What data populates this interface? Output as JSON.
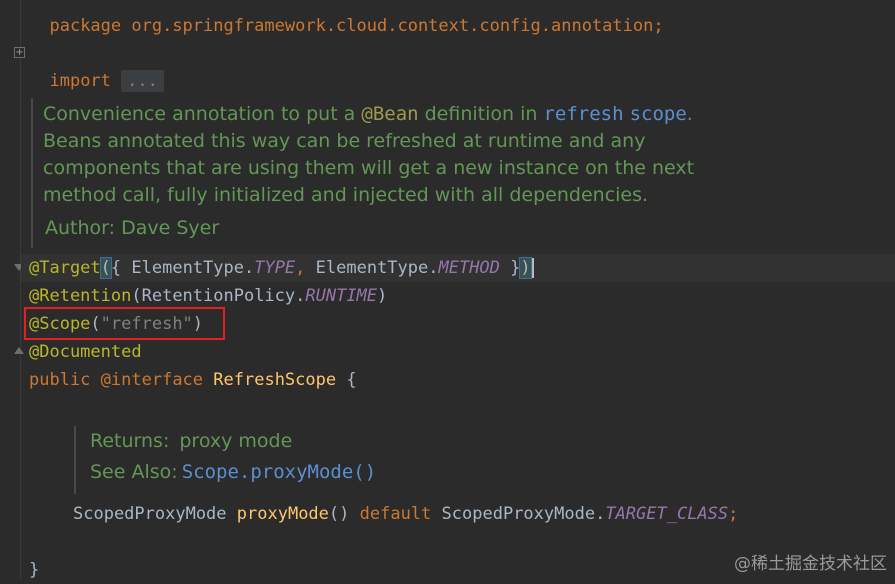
{
  "editor": {
    "line_package": "package org.springframework.cloud.context.config.annotation;",
    "import_keyword": "import",
    "import_ellipsis": "...",
    "doc_class": {
      "text_part1": "Convenience annotation to put a ",
      "text_bean": "@Bean",
      "text_part2": " definition in ",
      "text_refresh": "refresh",
      "text_scope": "scope",
      "text_part3": ". Beans annotated this way can be refreshed at runtime and any components that are using them will get a new instance on the next method call, fully initialized and injected with all dependencies.",
      "author": "Author: Dave Syer"
    },
    "target_line": {
      "annotation": "@Target",
      "open_paren": "(",
      "open_brace": "{ ",
      "enum1_class": "ElementType.",
      "enum1_value": "TYPE",
      "comma": ", ",
      "enum2_class": "ElementType.",
      "enum2_value": "METHOD",
      "close_brace": " }",
      "close_paren": ")"
    },
    "retention_line": {
      "annotation": "@Retention",
      "open": "(",
      "class": "RetentionPolicy.",
      "value": "RUNTIME",
      "close": ")"
    },
    "scope_line": {
      "annotation": "@Scope",
      "open": "(",
      "value": "\"refresh\"",
      "close": ")"
    },
    "documented_line": "@Documented",
    "interface_line": {
      "public_kw": "public",
      "interface_kw": "@interface",
      "name": "RefreshScope",
      "brace": "{"
    },
    "doc_method": {
      "returns_label": "Returns:",
      "returns_value": "proxy mode",
      "seealso_label": "See Also:",
      "seealso_class": "Scope",
      "seealso_member": ".proxyMode()"
    },
    "method_line": {
      "return_type": "ScopedProxyMode",
      "method_name": "proxyMode",
      "parens": "()",
      "default_kw": "default",
      "default_class": "ScopedProxyMode.",
      "default_value": "TARGET_CLASS",
      "semicolon": ";"
    },
    "closing_brace": "}"
  },
  "watermark": "@稀土掘金技术社区"
}
